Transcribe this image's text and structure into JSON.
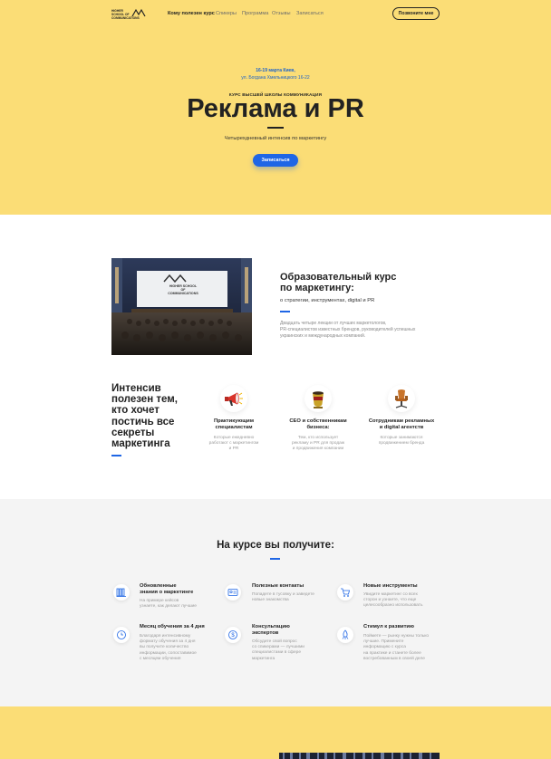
{
  "header": {
    "logo_text": "HIGHER SCHOOL OF COMMUNICATIONS",
    "nav": [
      "Кому полезен курс",
      "Спикеры",
      "Программа",
      "Отзывы",
      "Записаться"
    ],
    "call_button": "Позвоните мне"
  },
  "hero": {
    "date": "16-19 марта Киев,",
    "address": "ул. Богдана Хмельницкого 16-22",
    "kicker": "КУРС ВЫСШЕЙ ШКОЛЫ КОММУНИКАЦИЯ",
    "title": "Реклама и PR",
    "subtitle": "Четырехдневный интенсив по маркетингу",
    "button": "Записаться"
  },
  "about": {
    "title_line1": "Образовательный курс",
    "title_line2": "по маркетингу:",
    "subtitle": "о стратегии, инструментах, digital и PR",
    "text1": "Двадцать четыре лекции от лучших маркетологов,",
    "text2": "PR-специалистов известных брендов, руководителей успешных",
    "text3": "украинских и международных компаний.",
    "screen_text": "HIGHER SCHOOL OF COMMUNICATIONS"
  },
  "audience": {
    "heading": [
      "Интенсив",
      "полезен тем,",
      "кто хочет",
      "постичь все",
      "секреты",
      "маркетинга"
    ],
    "items": [
      {
        "icon": "megaphone-icon",
        "title1": "Практикующим",
        "title2": "специалистам",
        "text1": "Которые ежедневно",
        "text2": "работают с маркетингом",
        "text3": "и PR"
      },
      {
        "icon": "cup-icon",
        "title1": "СЕО и собственникам",
        "title2": "бизнеса:",
        "text1": "Тем, кто использует",
        "text2": "рекламу и PR для продаж",
        "text3": "и продвижения компании"
      },
      {
        "icon": "chair-icon",
        "title1": "Сотрудникам рекламных",
        "title2": "и digital агентств",
        "text1": "Которые занимаются",
        "text2": "продвижением бренда",
        "text3": ""
      }
    ]
  },
  "benefits": {
    "heading": "На курсе вы получите:",
    "items": [
      {
        "icon": "books-icon",
        "title1": "Обновленные",
        "title2": "знания о маркетинге",
        "lines": [
          "На примере кейсов",
          "узнаете, как делают лучшие"
        ]
      },
      {
        "icon": "contacts-icon",
        "title1": "Полезные контакты",
        "title2": "",
        "lines": [
          "Попадете в тусовку и заведете",
          "новые знакомства"
        ]
      },
      {
        "icon": "cart-icon",
        "title1": "Новые инструменты",
        "title2": "",
        "lines": [
          "Увидите маркетинг со всех",
          "сторон и узнаете, что еще",
          "целесообразно использовать"
        ]
      },
      {
        "icon": "clock-icon",
        "title1": "Месяц обучения за 4 дня",
        "title2": "",
        "lines": [
          "Благодаря интенсивному",
          "формату обучения за 4 дня",
          "вы получите количество",
          "информации, сопоставимое",
          "с месяцем обучения"
        ]
      },
      {
        "icon": "dollar-icon",
        "title1": "Консультацию",
        "title2": "экспертов",
        "lines": [
          "Обсудите свой вопрос",
          "со спикерами — лучшими",
          "специалистами в сфере",
          "маркетинга"
        ]
      },
      {
        "icon": "rocket-icon",
        "title1": "Стимул к развитию",
        "title2": "",
        "lines": [
          "Поймете — рынку нужны только",
          "лучшие. Примените",
          "информацию с курса",
          "на практике и станете более",
          "востребованным в своей деле"
        ]
      }
    ]
  },
  "colors": {
    "accent": "#1f66e5",
    "hero_bg": "#fbdd76",
    "gray_bg": "#f4f4f4"
  }
}
